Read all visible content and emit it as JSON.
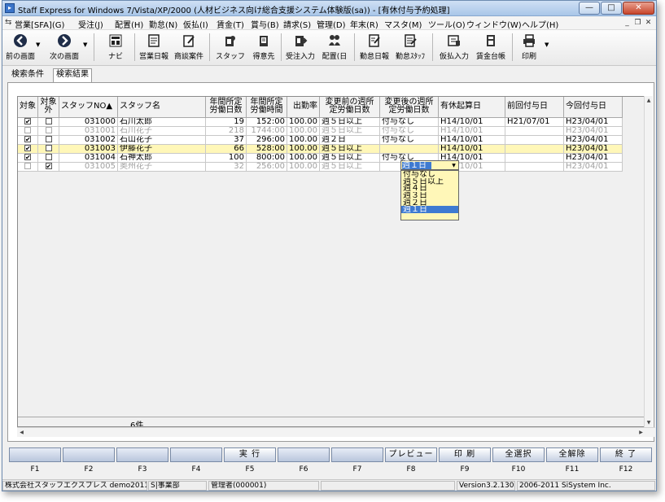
{
  "window": {
    "title": "Staff Express for Windows 7/Vista/XP/2000 (人材ビジネス向け総合支援システム体験版(sa)) - [有休付与予約処理]",
    "min_glyph": "—",
    "max_glyph": "□",
    "close_glyph": "✕"
  },
  "menu": {
    "items": [
      "営業[SFA](G)",
      "受注(J)",
      "配置(H)",
      "勤怠(N)",
      "仮払(I)",
      "賃金(T)",
      "賞与(B)",
      "請求(S)",
      "管理(D)",
      "年末(R)",
      "マスタ(M)",
      "ツール(O)",
      "ウィンドウ(W)",
      "ヘルプ(H)"
    ],
    "mdi_min": "_",
    "mdi_restore": "❐",
    "mdi_close": "✕"
  },
  "toolbar": {
    "back_label": "前の画面",
    "next_label": "次の画面",
    "navi_label": "ナビ",
    "sales_daily_label": "営業日報",
    "deal_label": "商談案件",
    "staff_label": "スタッフ",
    "client_label": "得意先",
    "order_label": "受注入力",
    "assign_label": "配置(日",
    "attend_daily_label": "勤怠日報",
    "attend_staff_label": "勤怠ｽﾀｯﾌ",
    "advance_label": "仮払入力",
    "wage_ledger_label": "賃金台帳",
    "print_label": "印刷"
  },
  "tabs": {
    "search_conditions": "検索条件",
    "search_results": "検索結果"
  },
  "grid": {
    "headers": {
      "target": "対象",
      "excluded_1": "対象",
      "excluded_2": "外",
      "staff_no": "スタッフNO▲",
      "staff_name": "スタッフ名",
      "annual_days_1": "年間所定",
      "annual_days_2": "労働日数",
      "annual_hours_1": "年間所定",
      "annual_hours_2": "労働時間",
      "attendance_rate": "出勤率",
      "before_1": "変更前の週所",
      "before_2": "定労働日数",
      "after_1": "変更後の週所",
      "after_2": "定労働日数",
      "leave_start": "有休起算日",
      "prev_grant": "前回付与日",
      "this_grant": "今回付与日"
    },
    "rows": [
      {
        "target": "✔",
        "excluded": "",
        "no": "031000",
        "name": "石川太郎",
        "days": "19",
        "hours": "152:00",
        "rate": "100.00",
        "before": "週５日以上",
        "after": "付与なし",
        "start": "H14/10/01",
        "prev": "H21/07/01",
        "grant": "H23/04/01"
      },
      {
        "target": "",
        "excluded": "",
        "no": "031001",
        "name": "石川花子",
        "days": "218",
        "hours": "1744:00",
        "rate": "100.00",
        "before": "週５日以上",
        "after": "付与なし",
        "start": "H14/10/01",
        "prev": "",
        "grant": "H23/04/01"
      },
      {
        "target": "✔",
        "excluded": "",
        "no": "031002",
        "name": "石山花子",
        "days": "37",
        "hours": "296:00",
        "rate": "100.00",
        "before": "週２日",
        "after": "付与なし",
        "start": "H14/10/01",
        "prev": "",
        "grant": "H23/04/01"
      },
      {
        "target": "✔",
        "excluded": "",
        "no": "031003",
        "name": "伊藤花子",
        "days": "66",
        "hours": "528:00",
        "rate": "100.00",
        "before": "週５日以上",
        "after": "週１日",
        "start": "H14/10/01",
        "prev": "",
        "grant": "H23/04/01"
      },
      {
        "target": "✔",
        "excluded": "",
        "no": "031004",
        "name": "石神太郎",
        "days": "100",
        "hours": "800:00",
        "rate": "100.00",
        "before": "週５日以上",
        "after": "付与なし",
        "start": "H14/10/01",
        "prev": "",
        "grant": "H23/04/01"
      },
      {
        "target": "",
        "excluded": "✔",
        "no": "031005",
        "name": "奥州花子",
        "days": "32",
        "hours": "256:00",
        "rate": "100.00",
        "before": "週５日以上",
        "after": "",
        "start": "H14/10/01",
        "prev": "",
        "grant": "H23/04/01"
      }
    ],
    "combo_value": "週１日",
    "combo_arrow": "▼",
    "options": [
      "付与なし",
      "週５日以上",
      "週４日",
      "週３日",
      "週２日",
      "週１日"
    ],
    "count": "6件"
  },
  "fkeys": {
    "f5": "実 行",
    "f8": "プレビュー",
    "f9": "印 刷",
    "f10": "全選択",
    "f11": "全解除",
    "f12": "終 了",
    "labels": [
      "F1",
      "F2",
      "F3",
      "F4",
      "F5",
      "F6",
      "F7",
      "F8",
      "F9",
      "F10",
      "F11",
      "F12"
    ]
  },
  "status": {
    "company": "株式会社スタッフエクスプレス demo201104",
    "branch": "S|事業部",
    "user": "管理者(000001)",
    "version": "Version3.2.130",
    "copyright": "2006-2011 SiSystem Inc."
  }
}
